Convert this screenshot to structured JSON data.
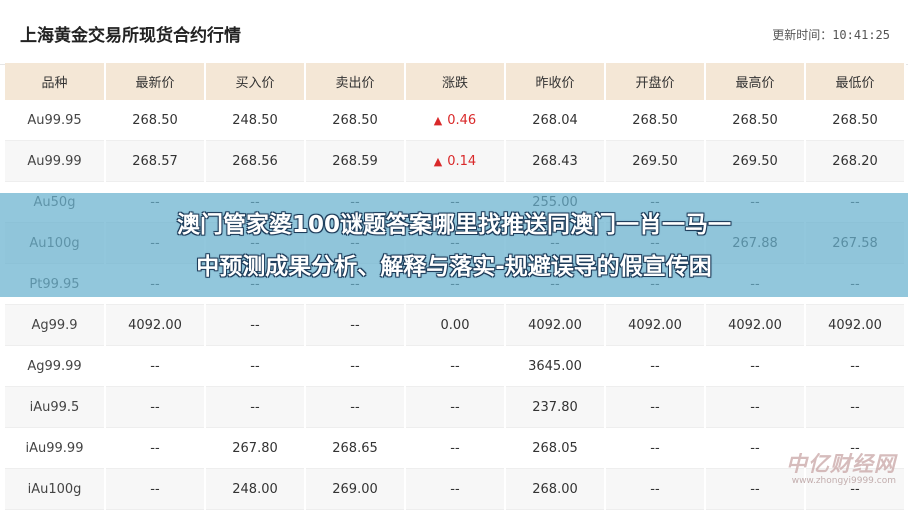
{
  "header": {
    "title": "上海黄金交易所现货合约行情",
    "update_label": "更新时间：",
    "update_time": "10:41:25"
  },
  "columns": [
    "品种",
    "最新价",
    "买入价",
    "卖出价",
    "涨跌",
    "昨收价",
    "开盘价",
    "最高价",
    "最低价"
  ],
  "rows": [
    {
      "name": "Au99.95",
      "latest": "268.50",
      "bid": "248.50",
      "ask": "268.50",
      "change": "0.46",
      "change_up": true,
      "prev_close": "268.04",
      "open": "268.50",
      "high": "268.50",
      "low": "268.50"
    },
    {
      "name": "Au99.99",
      "latest": "268.57",
      "bid": "268.56",
      "ask": "268.59",
      "change": "0.14",
      "change_up": true,
      "prev_close": "268.43",
      "open": "269.50",
      "high": "269.50",
      "low": "268.20"
    },
    {
      "name": "Au50g",
      "latest": "--",
      "bid": "--",
      "ask": "--",
      "change": "--",
      "change_up": false,
      "prev_close": "255.00",
      "open": "--",
      "high": "--",
      "low": "--"
    },
    {
      "name": "Au100g",
      "latest": "--",
      "bid": "--",
      "ask": "--",
      "change": "--",
      "change_up": false,
      "prev_close": "--",
      "open": "--",
      "high": "267.88",
      "low": "267.58"
    },
    {
      "name": "Pt99.95",
      "latest": "--",
      "bid": "--",
      "ask": "--",
      "change": "--",
      "change_up": false,
      "prev_close": "--",
      "open": "--",
      "high": "--",
      "low": "--"
    },
    {
      "name": "Ag99.9",
      "latest": "4092.00",
      "bid": "--",
      "ask": "--",
      "change": "0.00",
      "change_up": false,
      "prev_close": "4092.00",
      "open": "4092.00",
      "high": "4092.00",
      "low": "4092.00"
    },
    {
      "name": "Ag99.99",
      "latest": "--",
      "bid": "--",
      "ask": "--",
      "change": "--",
      "change_up": false,
      "prev_close": "3645.00",
      "open": "--",
      "high": "--",
      "low": "--"
    },
    {
      "name": "iAu99.5",
      "latest": "--",
      "bid": "--",
      "ask": "--",
      "change": "--",
      "change_up": false,
      "prev_close": "237.80",
      "open": "--",
      "high": "--",
      "low": "--"
    },
    {
      "name": "iAu99.99",
      "latest": "--",
      "bid": "267.80",
      "ask": "268.65",
      "change": "--",
      "change_up": false,
      "prev_close": "268.05",
      "open": "--",
      "high": "--",
      "low": "--"
    },
    {
      "name": "iAu100g",
      "latest": "--",
      "bid": "248.00",
      "ask": "269.00",
      "change": "--",
      "change_up": false,
      "prev_close": "268.00",
      "open": "--",
      "high": "--",
      "low": "--"
    }
  ],
  "banner": {
    "line1": "澳门管家婆100谜题答案哪里找推送同澳门一肖一马一",
    "line2": "中预测成果分析、解释与落实-规避误导的假宣传困"
  },
  "watermark": {
    "logo": "中亿财经网",
    "url": "www.zhongyi9999.com"
  },
  "colors": {
    "header_bg": "#f4e7d6",
    "up": "#d9292a",
    "banner_bg": "#68b2ce"
  }
}
